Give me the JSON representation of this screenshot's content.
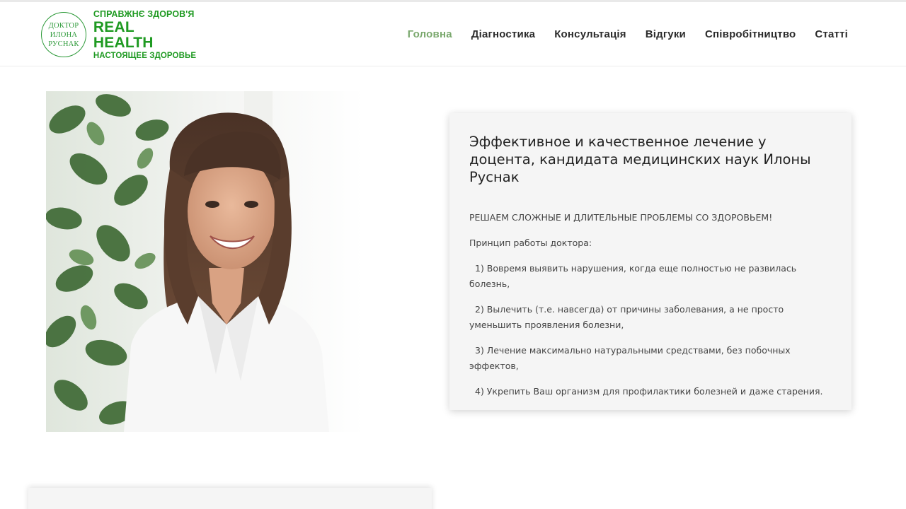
{
  "logo": {
    "circle_lines": [
      "ДОКТОР",
      "ИЛОНА",
      "РУСНАК"
    ],
    "line1": "СПРАВЖНЄ ЗДОРОВ'Я",
    "line2": "REAL HEALTH",
    "line3": "НАСТОЯЩЕЕ ЗДОРОВЬЕ",
    "brand_color": "#1f9a22"
  },
  "nav": {
    "items": [
      {
        "label": "Головна",
        "active": true
      },
      {
        "label": "Діагностика",
        "active": false
      },
      {
        "label": "Консультація",
        "active": false
      },
      {
        "label": "Відгуки",
        "active": false
      },
      {
        "label": "Співробітництво",
        "active": false
      },
      {
        "label": "Статті",
        "active": false
      }
    ],
    "active_color": "#7aa86d"
  },
  "hero": {
    "photo_subject": "doctor-portrait-photo",
    "title": "Эффективное и качественное лечение у доцента, кандидата медицинских наук Илоны Руснак",
    "tagline": "РЕШАЕМ СЛОЖНЫЕ И ДЛИТЕЛЬНЫЕ ПРОБЛЕМЫ СО ЗДОРОВЬЕМ!",
    "principles_heading": "Принцип работы доктора:",
    "principles": [
      "1) Вовремя выявить нарушения, когда еще полностью не развилась болезнь,",
      "2) Вылечить (т.е. навсегда) от причины заболевания, а не просто уменьшить проявления болезни,",
      "3) Лечение максимально натуральными средствами, без побочных эффектов,",
      "4) Укрепить Ваш организм для профилактики болезней и даже старения."
    ]
  }
}
